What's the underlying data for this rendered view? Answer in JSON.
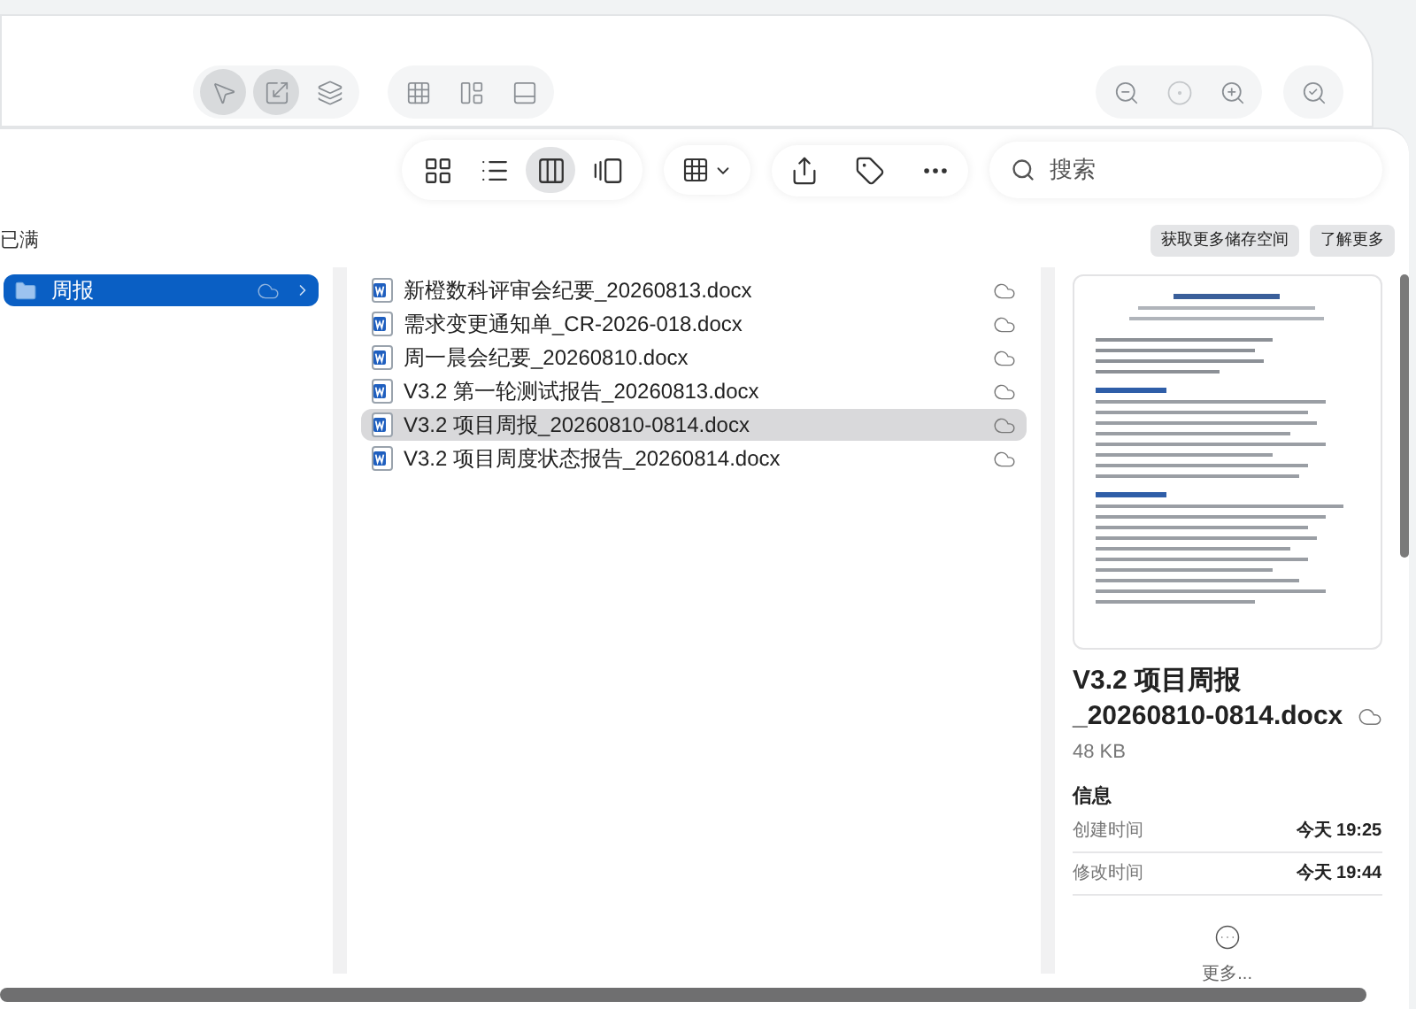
{
  "back_toolbar": [
    {
      "kind": "pointer",
      "selected": true
    },
    {
      "kind": "resize",
      "selected": true
    },
    {
      "kind": "layers",
      "selected": false
    },
    {
      "kind": "grid",
      "selected": false
    },
    {
      "kind": "layout",
      "selected": false
    },
    {
      "kind": "panel",
      "selected": false
    },
    {
      "kind": "zoom-out",
      "selected": false
    },
    {
      "kind": "zoom-reset",
      "selected": false
    },
    {
      "kind": "zoom-in",
      "selected": false
    },
    {
      "kind": "zoom-fit",
      "selected": false
    }
  ],
  "view_modes": [
    {
      "kind": "icons",
      "selected": false
    },
    {
      "kind": "list",
      "selected": false
    },
    {
      "kind": "columns",
      "selected": true
    },
    {
      "kind": "gallery",
      "selected": false
    }
  ],
  "search": {
    "placeholder": "搜索"
  },
  "storage_bar": {
    "label": "已满",
    "buttons": [
      "获取更多储存空间",
      "了解更多"
    ]
  },
  "column_1": [
    {
      "name": "周报",
      "selected": true
    }
  ],
  "files": [
    {
      "name": "新橙数科评审会纪要_20260813.docx",
      "selected": false
    },
    {
      "name": "需求变更通知单_CR-2026-018.docx",
      "selected": false
    },
    {
      "name": "周一晨会纪要_20260810.docx",
      "selected": false
    },
    {
      "name": "V3.2 第一轮测试报告_20260813.docx",
      "selected": false
    },
    {
      "name": "V3.2 项目周报_20260810-0814.docx",
      "selected": true
    },
    {
      "name": "V3.2 项目周度状态报告_20260814.docx",
      "selected": false
    }
  ],
  "preview": {
    "title_lines": [
      "V3.2 项目周报",
      "_20260810-0814.docx"
    ],
    "size": "48 KB",
    "info_heading": "信息",
    "info": [
      {
        "label": "创建时间",
        "value": "今天 19:25"
      },
      {
        "label": "修改时间",
        "value": "今天 19:44"
      }
    ],
    "more": "更多..."
  }
}
